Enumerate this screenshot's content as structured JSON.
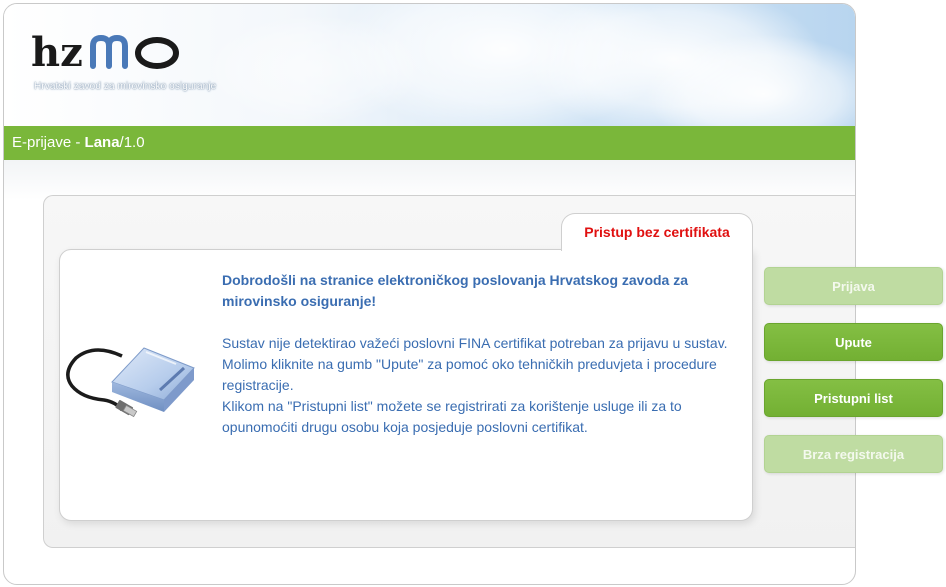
{
  "header": {
    "logo_text": "hzmo",
    "subtitle": "Hrvatski zavod za mirovinsko osiguranje"
  },
  "app_bar": {
    "prefix": "E-prijave - ",
    "app_name": "Lana",
    "version": "/1.0"
  },
  "tab": {
    "label": "Pristup bez certifikata"
  },
  "content": {
    "welcome": "Dobrodošli na stranice elektroničkog poslovanja Hrvatskog zavoda za mirovinsko osiguranje!",
    "lines": [
      "Sustav nije detektirao važeći poslovni FINA certifikat potreban za prijavu u sustav.",
      "Molimo kliknite na gumb \"Upute\" za pomoć oko tehničkih preduvjeta i procedure registracije.",
      "Klikom na \"Pristupni list\" možete se registrirati za korištenje usluge ili za to opunomoćiti drugu osobu koja posjeduje poslovni certifikat."
    ]
  },
  "sidebar": {
    "buttons": [
      {
        "label": "Prijava",
        "state": "disabled"
      },
      {
        "label": "Upute",
        "state": "active"
      },
      {
        "label": "Pristupni list",
        "state": "active"
      },
      {
        "label": "Brza registracija",
        "state": "disabled"
      }
    ]
  },
  "colors": {
    "green_bar": "#7ab73a",
    "link_blue": "#3a6db1",
    "tab_red": "#e01010",
    "button_active": "#7ab73a",
    "button_disabled": "#bfdca2"
  },
  "icons": [
    "hzmo-logo",
    "card-reader-icon"
  ]
}
